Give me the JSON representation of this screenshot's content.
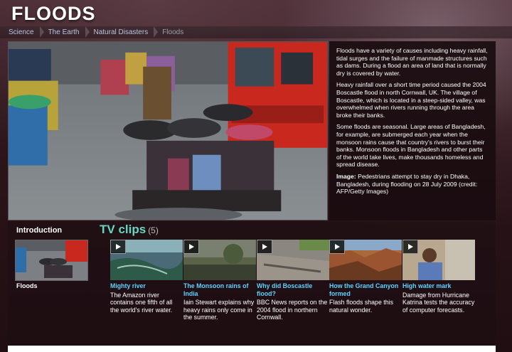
{
  "page": {
    "title": "FLOODS"
  },
  "breadcrumb": [
    "Science",
    "The Earth",
    "Natural Disasters",
    "Floods"
  ],
  "hero": {
    "image_alt": "Pedestrians attempt to stay dry in Dhaka, Bangladesh"
  },
  "description": {
    "paragraphs": [
      "Floods have a variety of causes including heavy rainfall, tidal surges and the failure of manmade structures such as dams. During a flood an area of land that is normally dry is covered by water.",
      "Heavy rainfall over a short time period caused the 2004 Boscastle flood in north Cornwall, UK. The village of Boscastle, which is located in a steep-sided valley, was overwhelmed when rivers running through the area broke their banks.",
      "Some floods are seasonal. Large areas of Bangladesh, for example, are submerged each year when the monsoon rains cause that country's rivers to burst their banks. Monsoon floods in Bangladesh and other parts of the world take lives, make thousands homeless and spread disease."
    ],
    "caption_label": "Image:",
    "caption_text": " Pedestrians attempt to stay dry in Dhaka, Bangladesh, during flooding on 28 July 2009 (credit: AFP/Getty Images)"
  },
  "intro": {
    "heading": "Introduction",
    "label": "Floods"
  },
  "tv": {
    "heading": "TV clips",
    "count": "(5)",
    "clips": [
      {
        "title": "Mighty river",
        "desc": "The Amazon river contains one fifth of all the world's river water."
      },
      {
        "title": "The Monsoon rains of India",
        "desc": "Iain Stewart explains why heavy rains only come in the summer."
      },
      {
        "title": "Why did Boscastle flood?",
        "desc": "BBC News reports on the 2004 flood in northern Cornwall."
      },
      {
        "title": "How the Grand Canyon formed",
        "desc": "Flash floods shape this natural wonder."
      },
      {
        "title": "High water mark",
        "desc": "Damage from Hurricane Katrina tests the accuracy of computer forecasts."
      }
    ]
  },
  "colors": {
    "accent_teal": "#66d7c0",
    "link_blue": "#5fd4ff",
    "crumb_blue": "#b9c4dc"
  }
}
